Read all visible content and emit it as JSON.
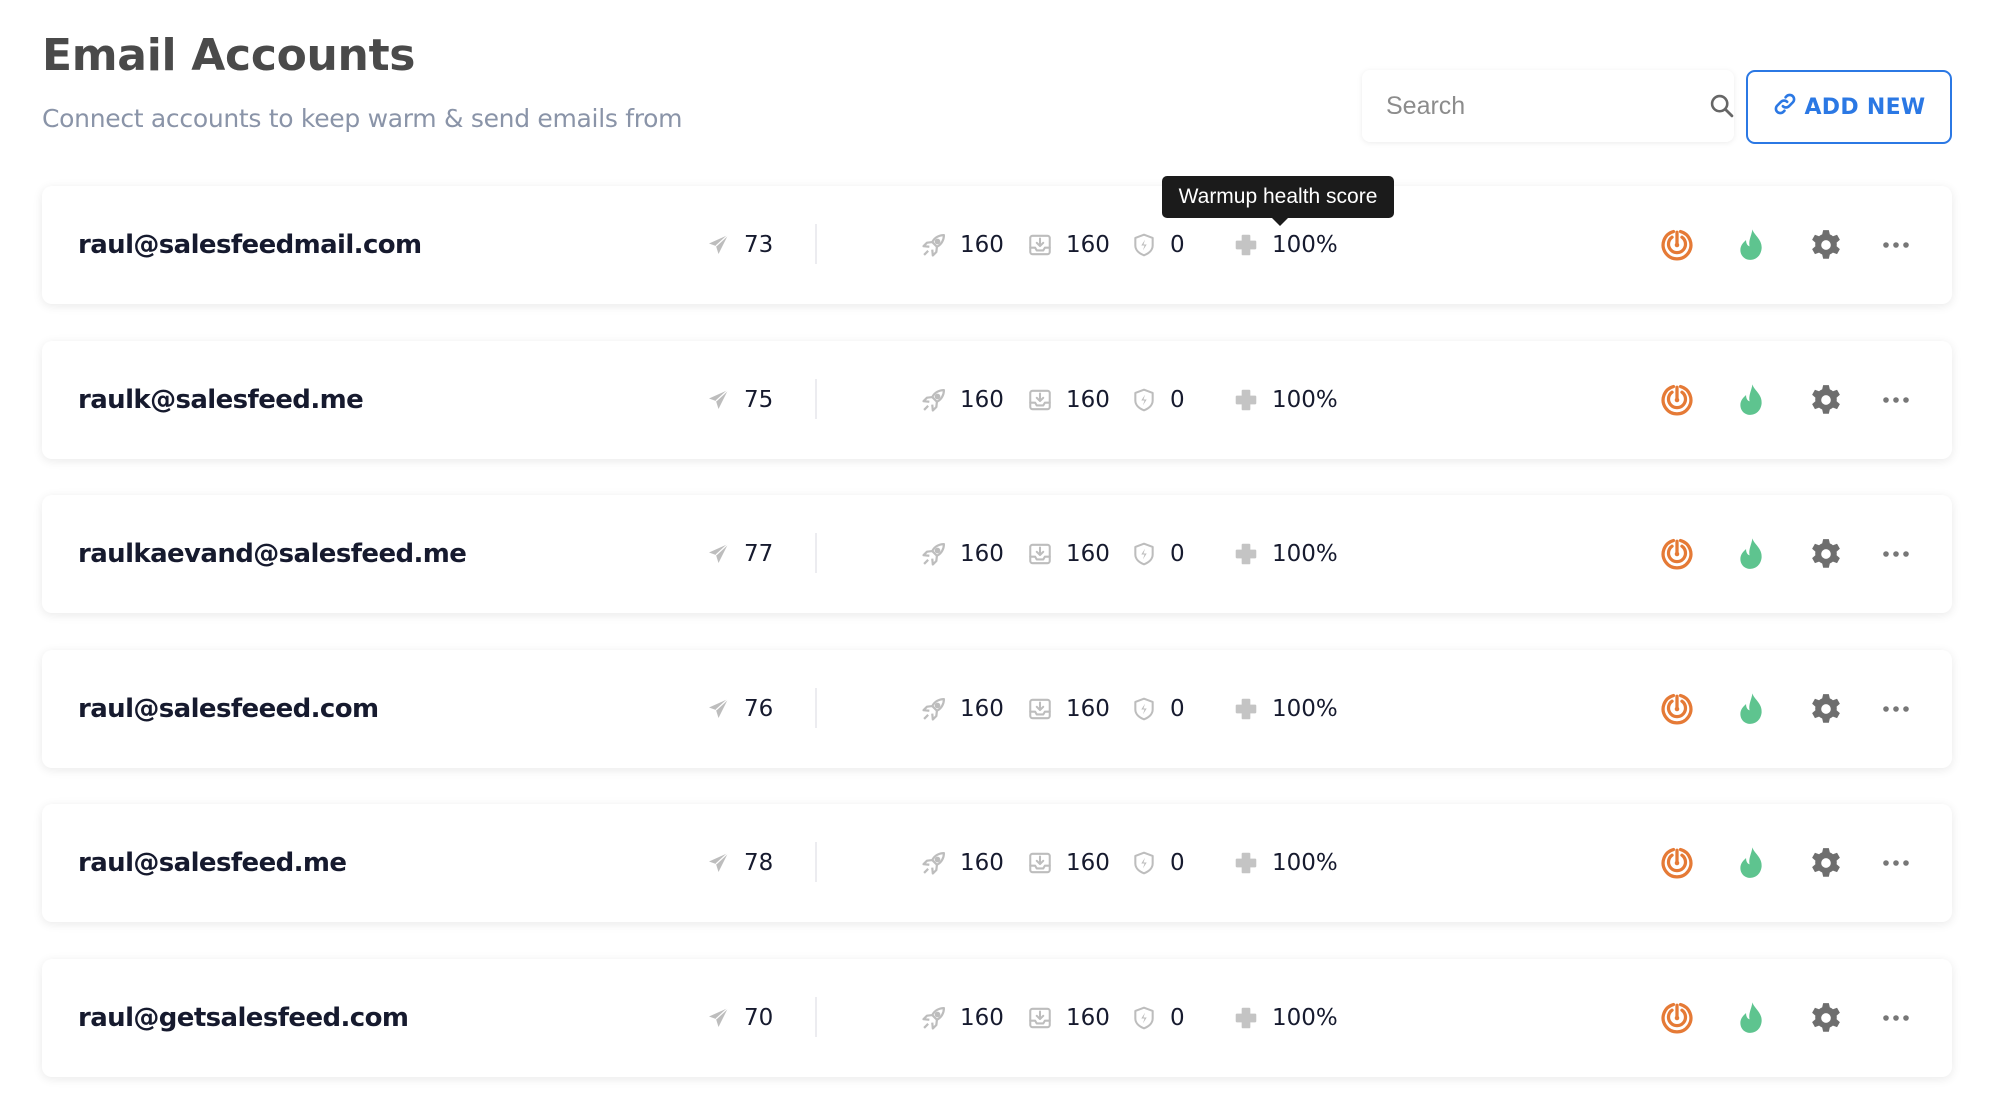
{
  "header": {
    "title": "Email Accounts",
    "subtitle": "Connect accounts to keep warm & send emails from"
  },
  "search": {
    "placeholder": "Search",
    "value": ""
  },
  "add_new": {
    "label": "ADD NEW",
    "icon": "link-icon"
  },
  "tooltip": {
    "text": "Warmup health score"
  },
  "colors": {
    "accent": "#2b78e4",
    "radar": "#e57a36",
    "flame": "#5ec48f",
    "gear": "#6e6e6e",
    "icon_gray": "#bdbdbd"
  },
  "stat_icons": {
    "sent": "paper-plane-icon",
    "warmup_sent": "rocket-icon",
    "inbox": "inbox-download-icon",
    "spam": "shield-bolt-icon",
    "health": "health-cross-icon"
  },
  "action_icons": [
    "radar-icon",
    "flame-icon",
    "gear-icon",
    "more-dots-icon"
  ],
  "accounts": [
    {
      "email": "raul@salesfeedmail.com",
      "sent": "73",
      "warmup_sent": "160",
      "inbox": "160",
      "spam": "0",
      "health": "100%"
    },
    {
      "email": "raulk@salesfeed.me",
      "sent": "75",
      "warmup_sent": "160",
      "inbox": "160",
      "spam": "0",
      "health": "100%"
    },
    {
      "email": "raulkaevand@salesfeed.me",
      "sent": "77",
      "warmup_sent": "160",
      "inbox": "160",
      "spam": "0",
      "health": "100%"
    },
    {
      "email": "raul@salesfeeed.com",
      "sent": "76",
      "warmup_sent": "160",
      "inbox": "160",
      "spam": "0",
      "health": "100%"
    },
    {
      "email": "raul@salesfeed.me",
      "sent": "78",
      "warmup_sent": "160",
      "inbox": "160",
      "spam": "0",
      "health": "100%"
    },
    {
      "email": "raul@getsalesfeed.com",
      "sent": "70",
      "warmup_sent": "160",
      "inbox": "160",
      "spam": "0",
      "health": "100%"
    }
  ]
}
